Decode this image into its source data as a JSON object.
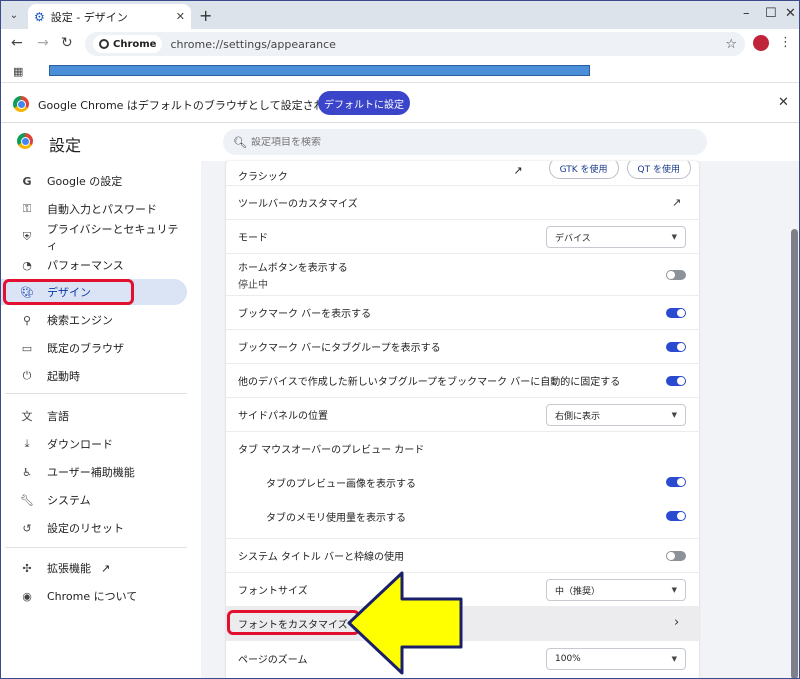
{
  "tab": {
    "title": "設定 - デザイン"
  },
  "omnibox": {
    "chip": "Chrome",
    "url": "chrome://settings/appearance"
  },
  "infobar": {
    "message": "Google Chrome はデフォルトのブラウザとして設定されていません",
    "button": "デフォルトに設定"
  },
  "header": {
    "title": "設定",
    "search_placeholder": "設定項目を検索"
  },
  "sidebar": {
    "items": [
      {
        "label": "Google の設定",
        "icon": "google-g-icon"
      },
      {
        "label": "自動入力とパスワード",
        "icon": "key-icon"
      },
      {
        "label": "プライバシーとセキュリティ",
        "icon": "shield-icon"
      },
      {
        "label": "パフォーマンス",
        "icon": "gauge-icon"
      },
      {
        "label": "デザイン",
        "icon": "palette-icon",
        "active": true
      },
      {
        "label": "検索エンジン",
        "icon": "search-icon"
      },
      {
        "label": "既定のブラウザ",
        "icon": "browser-icon"
      },
      {
        "label": "起動時",
        "icon": "power-icon"
      },
      {
        "label": "言語",
        "icon": "translate-icon"
      },
      {
        "label": "ダウンロード",
        "icon": "download-icon"
      },
      {
        "label": "ユーザー補助機能",
        "icon": "accessibility-icon"
      },
      {
        "label": "システム",
        "icon": "wrench-icon"
      },
      {
        "label": "設定のリセット",
        "icon": "reset-icon"
      },
      {
        "label": "拡張機能",
        "icon": "puzzle-icon"
      },
      {
        "label": "Chrome について",
        "icon": "chrome-icon"
      }
    ]
  },
  "appearance": {
    "theme_label": "クラシック",
    "gtk_button": "GTK を使用",
    "qt_button": "QT を使用",
    "customize_toolbar": "ツールバーのカスタマイズ",
    "mode_label": "モード",
    "mode_value": "デバイス",
    "home_button_label": "ホームボタンを表示する",
    "home_button_sub": "停止中",
    "show_bookmarks_bar": "ブックマーク バーを表示する",
    "show_tab_groups_in_bookmarks": "ブックマーク バーにタブグループを表示する",
    "pin_tab_groups": "他のデバイスで作成した新しいタブグループをブックマーク バーに自動的に固定する",
    "side_panel_label": "サイドパネルの位置",
    "side_panel_value": "右側に表示",
    "hover_preview_label": "タブ マウスオーバーのプレビュー カード",
    "show_preview_image": "タブのプレビュー画像を表示する",
    "show_memory_usage": "タブのメモリ使用量を表示する",
    "system_title_bar": "システム タイトル バーと枠線の使用",
    "font_size_label": "フォントサイズ",
    "font_size_value": "中（推奨）",
    "customize_fonts": "フォントをカスタマイズ",
    "page_zoom_label": "ページのズーム",
    "page_zoom_value": "100%"
  },
  "toggles": {
    "home_button": false,
    "bookmarks_bar": true,
    "tab_groups_bookmarks": true,
    "pin_tab_groups": true,
    "preview_image": true,
    "memory_usage": true,
    "system_title_bar": false
  },
  "colors": {
    "accent": "#2a4bd0",
    "highlight": "#e2102e",
    "arrow": "#ffff00"
  }
}
